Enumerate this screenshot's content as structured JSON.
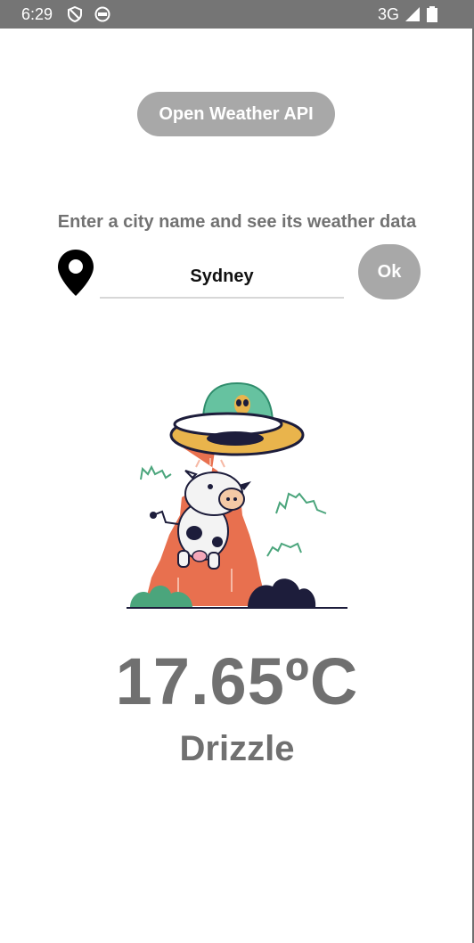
{
  "status_bar": {
    "time": "6:29",
    "network": "3G",
    "icons": [
      "shield-icon",
      "face-icon",
      "signal-icon",
      "battery-icon"
    ]
  },
  "api_button": {
    "label": "Open Weather API"
  },
  "prompt": "Enter a city name and see its weather data",
  "search": {
    "value": "Sydney",
    "icon": "location-pin-icon"
  },
  "ok_button": {
    "label": "Ok"
  },
  "weather": {
    "temperature": "17.65ºC",
    "condition": "Drizzle",
    "illustration": "ufo-abducting-cow-illustration"
  },
  "colors": {
    "status_bar": "#757575",
    "button_bg": "#a8a8a8",
    "text_gray": "#707070",
    "beam": "#e8704f",
    "ufo_yellow": "#e9b44c",
    "dome_green": "#66c2a0",
    "navy": "#1d1d3b"
  }
}
